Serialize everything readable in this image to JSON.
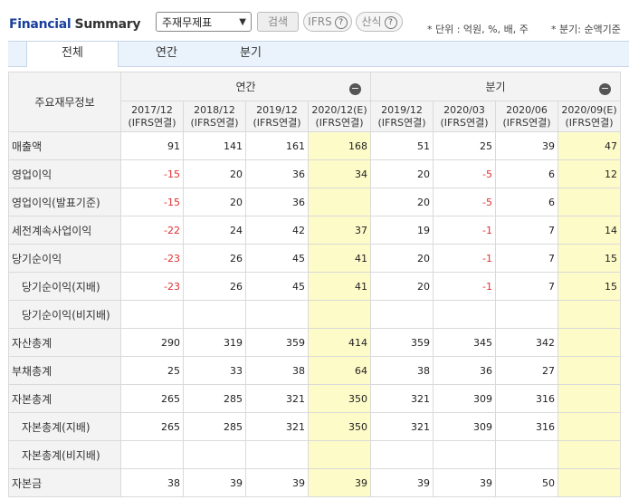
{
  "header": {
    "title_part1": "Financial",
    "title_part2": "Summary",
    "select_value": "주재무제표",
    "search_label": "검색",
    "ifrs_label": "IFRS",
    "calc_label": "산식",
    "help_glyph": "?",
    "unit_note": "* 단위 : 억원, %, 배, 주",
    "period_note": "* 분기: 순액기준"
  },
  "tabs": {
    "all": "전체",
    "annual": "연간",
    "quarter": "분기"
  },
  "table": {
    "corner_label": "주요재무정보",
    "group_annual": "연간",
    "group_quarter": "분기",
    "collapse_glyph": "−",
    "periods": [
      {
        "date": "2017/12",
        "basis": "(IFRS연결)"
      },
      {
        "date": "2018/12",
        "basis": "(IFRS연결)"
      },
      {
        "date": "2019/12",
        "basis": "(IFRS연결)"
      },
      {
        "date": "2020/12(E)",
        "basis": "(IFRS연결)"
      },
      {
        "date": "2019/12",
        "basis": "(IFRS연결)"
      },
      {
        "date": "2020/03",
        "basis": "(IFRS연결)"
      },
      {
        "date": "2020/06",
        "basis": "(IFRS연결)"
      },
      {
        "date": "2020/09(E)",
        "basis": "(IFRS연결)"
      }
    ],
    "rows": [
      {
        "label": "매출액",
        "indent": false,
        "values": [
          "91",
          "141",
          "161",
          "168",
          "51",
          "25",
          "39",
          "47"
        ]
      },
      {
        "label": "영업이익",
        "indent": false,
        "values": [
          "-15",
          "20",
          "36",
          "34",
          "20",
          "-5",
          "6",
          "12"
        ]
      },
      {
        "label": "영업이익(발표기준)",
        "indent": false,
        "values": [
          "-15",
          "20",
          "36",
          "",
          "20",
          "-5",
          "6",
          ""
        ]
      },
      {
        "label": "세전계속사업이익",
        "indent": false,
        "values": [
          "-22",
          "24",
          "42",
          "37",
          "19",
          "-1",
          "7",
          "14"
        ]
      },
      {
        "label": "당기순이익",
        "indent": false,
        "values": [
          "-23",
          "26",
          "45",
          "41",
          "20",
          "-1",
          "7",
          "15"
        ]
      },
      {
        "label": "당기순이익(지배)",
        "indent": true,
        "values": [
          "-23",
          "26",
          "45",
          "41",
          "20",
          "-1",
          "7",
          "15"
        ]
      },
      {
        "label": "당기순이익(비지배)",
        "indent": true,
        "values": [
          "",
          "",
          "",
          "",
          "",
          "",
          "",
          ""
        ]
      },
      {
        "label": "자산총계",
        "indent": false,
        "values": [
          "290",
          "319",
          "359",
          "414",
          "359",
          "345",
          "342",
          ""
        ]
      },
      {
        "label": "부채총계",
        "indent": false,
        "values": [
          "25",
          "33",
          "38",
          "64",
          "38",
          "36",
          "27",
          ""
        ]
      },
      {
        "label": "자본총계",
        "indent": false,
        "values": [
          "265",
          "285",
          "321",
          "350",
          "321",
          "309",
          "316",
          ""
        ]
      },
      {
        "label": "자본총계(지배)",
        "indent": true,
        "values": [
          "265",
          "285",
          "321",
          "350",
          "321",
          "309",
          "316",
          ""
        ]
      },
      {
        "label": "자본총계(비지배)",
        "indent": true,
        "values": [
          "",
          "",
          "",
          "",
          "",
          "",
          "",
          ""
        ]
      },
      {
        "label": "자본금",
        "indent": false,
        "values": [
          "38",
          "39",
          "39",
          "39",
          "39",
          "39",
          "50",
          ""
        ]
      }
    ],
    "colors": {
      "estimate_bg": "#fdfbc8",
      "negative": "#e03030",
      "brand": "#1a3f9c"
    }
  }
}
